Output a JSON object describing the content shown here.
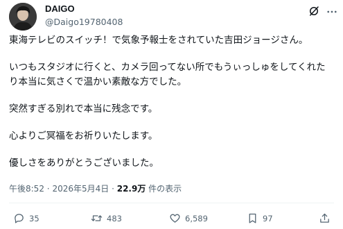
{
  "author": {
    "name": "DAIGO",
    "handle": "@Daigo19780408"
  },
  "tweet": {
    "paragraphs": [
      "東海テレビのスイッチ！で気象予報士をされていた吉田ジョージさん。",
      "いつもスタジオに行くと、カメラ回ってない所でもうぃっしゅをしてくれたり本当に気さくで温かい素敵な方でした。",
      "突然すぎる別れで本当に残念です。",
      "心よりご冥福をお祈りいたします。",
      "優しさをありがとうございました。"
    ]
  },
  "meta": {
    "time": "午後8:52",
    "separator": "·",
    "date": "2026年5月4日",
    "views_count": "22.9万",
    "views_label": "件の表示"
  },
  "actions": {
    "reply_count": "35",
    "retweet_count": "483",
    "like_count": "6,589",
    "bookmark_count": "97"
  },
  "icons": [
    "grok-icon",
    "more-icon",
    "reply-icon",
    "retweet-icon",
    "like-icon",
    "bookmark-icon",
    "share-icon"
  ],
  "colors": {
    "text": "#0f1419",
    "secondary": "#536471",
    "divider": "#eff3f4"
  }
}
